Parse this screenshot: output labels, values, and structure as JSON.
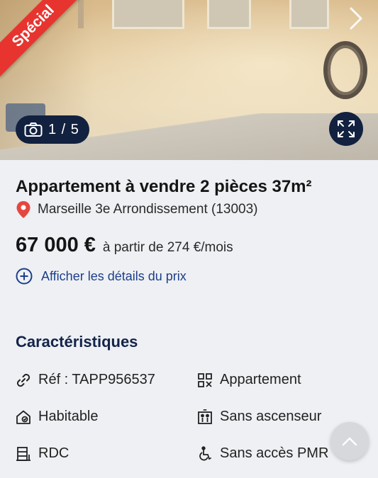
{
  "gallery": {
    "badge": "Spécial",
    "counter": "1 / 5"
  },
  "listing": {
    "title": "Appartement à vendre 2 pièces 37m²",
    "location": "Marseille 3e Arrondissement (13003)",
    "price": "67 000 €",
    "monthly": "à partir de 274 €/mois",
    "details_link": "Afficher les détails du prix"
  },
  "characteristics": {
    "title": "Caractéristiques",
    "items": [
      {
        "label": "Réf : TAPP956537",
        "icon": "link-icon"
      },
      {
        "label": "Appartement",
        "icon": "building-icon"
      },
      {
        "label": "Habitable",
        "icon": "home-check-icon"
      },
      {
        "label": "Sans ascenseur",
        "icon": "elevator-icon"
      },
      {
        "label": "RDC",
        "icon": "floor-icon"
      },
      {
        "label": "Sans accès PMR",
        "icon": "wheelchair-icon"
      }
    ]
  },
  "colors": {
    "accent": "#12213f",
    "ribbon": "#e8342f",
    "link": "#1d3f8a"
  }
}
